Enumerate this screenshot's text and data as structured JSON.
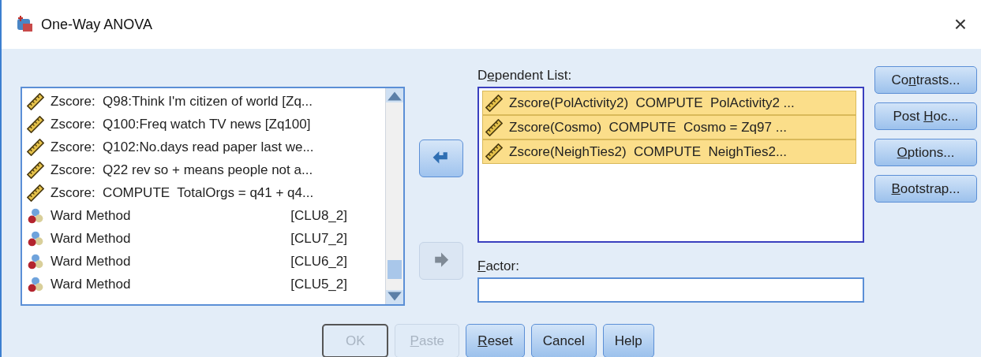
{
  "window": {
    "title": "One-Way ANOVA",
    "close": "×"
  },
  "variables": [
    {
      "kind": "scale",
      "name": "Zscore:  Q98:Think I'm citizen of world [Zq...",
      "selected": false
    },
    {
      "kind": "scale",
      "name": "Zscore:  Q100:Freq watch TV news [Zq100]",
      "selected": false
    },
    {
      "kind": "scale",
      "name": "Zscore:  Q102:No.days read paper last we...",
      "selected": false
    },
    {
      "kind": "scale",
      "name": "Zscore:  Q22 rev so + means people not a...",
      "selected": false
    },
    {
      "kind": "scale",
      "name": "Zscore:  COMPUTE  TotalOrgs = q41 + q4...",
      "selected": false
    },
    {
      "kind": "nominal",
      "name": "Ward Method",
      "code": "[CLU8_2]",
      "selected": false
    },
    {
      "kind": "nominal",
      "name": "Ward Method",
      "code": "[CLU7_2]",
      "selected": false
    },
    {
      "kind": "nominal",
      "name": "Ward Method",
      "code": "[CLU6_2]",
      "selected": false
    },
    {
      "kind": "nominal",
      "name": "Ward Method",
      "code": "[CLU5_2]",
      "selected": false
    }
  ],
  "move_buttons": [
    {
      "kind": "back",
      "disabled": false
    },
    {
      "kind": "forward",
      "disabled": true
    }
  ],
  "dependent_list": {
    "label": {
      "before": "D",
      "key": "e",
      "after": "pendent List:"
    },
    "items": [
      {
        "kind": "scale",
        "name": "Zscore(PolActivity2)  COMPUTE  PolActivity2 ...",
        "selected": true
      },
      {
        "kind": "scale",
        "name": "Zscore(Cosmo)  COMPUTE  Cosmo = Zq97 ...",
        "selected": true
      },
      {
        "kind": "scale",
        "name": "Zscore(NeighTies2)  COMPUTE  NeighTies2...",
        "selected": true
      }
    ]
  },
  "factor": {
    "label": {
      "key": "F",
      "after": "actor:"
    }
  },
  "side_buttons": [
    {
      "label": {
        "before": "Co",
        "key": "n",
        "after": "trasts..."
      }
    },
    {
      "label": {
        "before": "Post ",
        "key": "H",
        "after": "oc..."
      }
    },
    {
      "label": {
        "key": "O",
        "after": "ptions..."
      }
    },
    {
      "label": {
        "key": "B",
        "after": "ootstrap..."
      }
    }
  ],
  "bottom_buttons": [
    {
      "label": {
        "before": "OK"
      },
      "disabled": true
    },
    {
      "label": {
        "key": "P",
        "after": "aste"
      },
      "disabled": true
    },
    {
      "label": {
        "key": "R",
        "after": "eset"
      },
      "disabled": false
    },
    {
      "label": {
        "before": "Cancel"
      },
      "disabled": false
    },
    {
      "label": {
        "before": "Help"
      },
      "disabled": false
    }
  ]
}
